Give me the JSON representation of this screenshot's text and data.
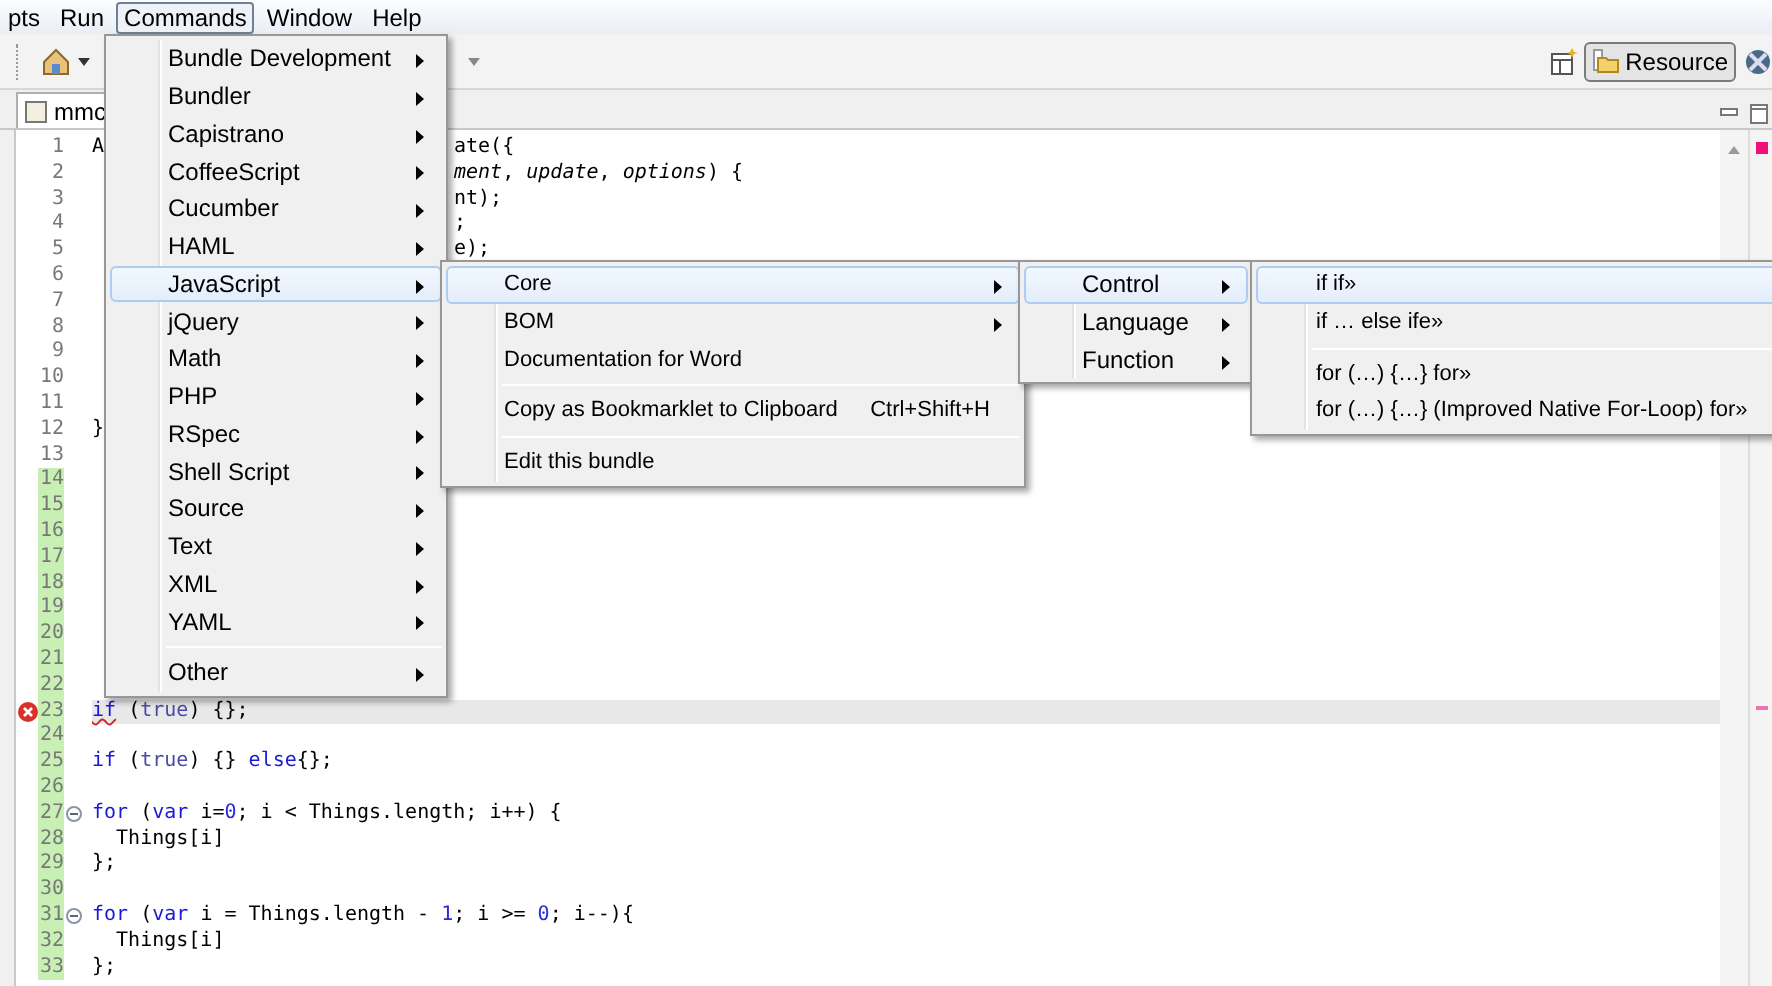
{
  "menu_bar": [
    {
      "label": "pts",
      "selected": false
    },
    {
      "label": "Run",
      "selected": false
    },
    {
      "label": "Commands",
      "selected": true
    },
    {
      "label": "Window",
      "selected": false
    },
    {
      "label": "Help",
      "selected": false
    }
  ],
  "toolbar": {
    "perspectives": [
      {
        "label": "Resource",
        "selected": true
      }
    ]
  },
  "editor": {
    "tab": "mmc",
    "lines": [
      {
        "number": "1",
        "changed": false,
        "left": [
          {
            "text": "A"
          }
        ],
        "right": [
          {
            "text": "ate({"
          }
        ]
      },
      {
        "number": "2",
        "changed": false,
        "right": [
          {
            "text": "ment",
            "kind": "param"
          },
          {
            "text": ", "
          },
          {
            "text": "update",
            "kind": "param"
          },
          {
            "text": ", "
          },
          {
            "text": "options",
            "kind": "param"
          },
          {
            "text": ") {"
          }
        ]
      },
      {
        "number": "3",
        "changed": false,
        "right": [
          {
            "text": "nt);"
          }
        ]
      },
      {
        "number": "4",
        "changed": false,
        "right": [
          {
            "text": ";"
          }
        ]
      },
      {
        "number": "5",
        "changed": false,
        "right": [
          {
            "text": "e);"
          }
        ]
      },
      {
        "number": "6",
        "changed": false
      },
      {
        "number": "7",
        "changed": false
      },
      {
        "number": "8",
        "changed": false
      },
      {
        "number": "9",
        "changed": false
      },
      {
        "number": "10",
        "changed": false
      },
      {
        "number": "11",
        "changed": false
      },
      {
        "number": "12",
        "changed": false,
        "left": [
          {
            "text": "}"
          }
        ]
      },
      {
        "number": "13",
        "changed": false
      },
      {
        "number": "14",
        "changed": true
      },
      {
        "number": "15",
        "changed": true
      },
      {
        "number": "16",
        "changed": true
      },
      {
        "number": "17",
        "changed": true
      },
      {
        "number": "18",
        "changed": true
      },
      {
        "number": "19",
        "changed": true
      },
      {
        "number": "20",
        "changed": true
      },
      {
        "number": "21",
        "changed": true
      },
      {
        "number": "22",
        "changed": true
      },
      {
        "number": "23",
        "changed": true,
        "error": true,
        "current": true,
        "left": [
          {
            "text": "if",
            "kind": "keyword",
            "error": true
          },
          {
            "text": " ("
          },
          {
            "text": "true",
            "kind": "literal"
          },
          {
            "text": ") {};"
          }
        ]
      },
      {
        "number": "24",
        "changed": true
      },
      {
        "number": "25",
        "changed": true,
        "left": [
          {
            "text": "if",
            "kind": "keyword"
          },
          {
            "text": " ("
          },
          {
            "text": "true",
            "kind": "literal"
          },
          {
            "text": ") {} "
          },
          {
            "text": "else",
            "kind": "keyword"
          },
          {
            "text": "{};"
          }
        ]
      },
      {
        "number": "26",
        "changed": true
      },
      {
        "number": "27",
        "changed": true,
        "fold": true,
        "left": [
          {
            "text": "for",
            "kind": "keyword"
          },
          {
            "text": " ("
          },
          {
            "text": "var",
            "kind": "keyword"
          },
          {
            "text": " i="
          },
          {
            "text": "0",
            "kind": "number"
          },
          {
            "text": "; i < Things.length; i++) {"
          }
        ]
      },
      {
        "number": "28",
        "changed": true,
        "left": [
          {
            "text": "  Things[i]"
          }
        ]
      },
      {
        "number": "29",
        "changed": true,
        "left": [
          {
            "text": "};"
          }
        ]
      },
      {
        "number": "30",
        "changed": true
      },
      {
        "number": "31",
        "changed": true,
        "fold": true,
        "left": [
          {
            "text": "for",
            "kind": "keyword"
          },
          {
            "text": " ("
          },
          {
            "text": "var",
            "kind": "keyword"
          },
          {
            "text": " i = Things.length - "
          },
          {
            "text": "1",
            "kind": "number"
          },
          {
            "text": "; i >= "
          },
          {
            "text": "0",
            "kind": "number"
          },
          {
            "text": "; i--){"
          }
        ]
      },
      {
        "number": "32",
        "changed": true,
        "left": [
          {
            "text": "  Things[i]"
          }
        ]
      },
      {
        "number": "33",
        "changed": true,
        "left": [
          {
            "text": "};"
          }
        ]
      }
    ]
  },
  "menus": [
    {
      "items": [
        {
          "kind": "item",
          "label": "Bundle Development",
          "submenu": true,
          "selected": false
        },
        {
          "kind": "item",
          "label": "Bundler",
          "submenu": true,
          "selected": false
        },
        {
          "kind": "item",
          "label": "Capistrano",
          "submenu": true,
          "selected": false
        },
        {
          "kind": "item",
          "label": "CoffeeScript",
          "submenu": true,
          "selected": false
        },
        {
          "kind": "item",
          "label": "Cucumber",
          "submenu": true,
          "selected": false
        },
        {
          "kind": "item",
          "label": "HAML",
          "submenu": true,
          "selected": false
        },
        {
          "kind": "item",
          "label": "JavaScript",
          "submenu": true,
          "selected": true
        },
        {
          "kind": "item",
          "label": "jQuery",
          "submenu": true,
          "selected": false
        },
        {
          "kind": "item",
          "label": "Math",
          "submenu": true,
          "selected": false
        },
        {
          "kind": "item",
          "label": "PHP",
          "submenu": true,
          "selected": false
        },
        {
          "kind": "item",
          "label": "RSpec",
          "submenu": true,
          "selected": false
        },
        {
          "kind": "item",
          "label": "Shell Script",
          "submenu": true,
          "selected": false
        },
        {
          "kind": "item",
          "label": "Source",
          "submenu": true,
          "selected": false
        },
        {
          "kind": "item",
          "label": "Text",
          "submenu": true,
          "selected": false
        },
        {
          "kind": "item",
          "label": "XML",
          "submenu": true,
          "selected": false
        },
        {
          "kind": "item",
          "label": "YAML",
          "submenu": true,
          "selected": false
        },
        {
          "kind": "separator"
        },
        {
          "kind": "item",
          "label": "Other",
          "submenu": true,
          "selected": false
        }
      ]
    },
    {
      "items": [
        {
          "kind": "item",
          "label": "Core",
          "submenu": true,
          "selected": true
        },
        {
          "kind": "item",
          "label": "BOM",
          "submenu": true,
          "selected": false
        },
        {
          "kind": "item",
          "label": "Documentation for Word",
          "submenu": false,
          "selected": false
        },
        {
          "kind": "separator"
        },
        {
          "kind": "item",
          "label": "Copy as Bookmarklet to Clipboard",
          "shortcut": "Ctrl+Shift+H",
          "submenu": false,
          "selected": false
        },
        {
          "kind": "separator"
        },
        {
          "kind": "item",
          "label": "Edit this bundle",
          "submenu": false,
          "selected": false
        }
      ]
    },
    {
      "items": [
        {
          "kind": "item",
          "label": "Control",
          "submenu": true,
          "selected": true
        },
        {
          "kind": "item",
          "label": "Language",
          "submenu": true,
          "selected": false
        },
        {
          "kind": "item",
          "label": "Function",
          "submenu": true,
          "selected": false
        }
      ]
    },
    {
      "items": [
        {
          "kind": "item",
          "label": "if if»",
          "submenu": false,
          "selected": true
        },
        {
          "kind": "item",
          "label": "if … else ife»",
          "submenu": false,
          "selected": false
        },
        {
          "kind": "separator"
        },
        {
          "kind": "item",
          "label": "for (…) {…} for»",
          "submenu": false,
          "selected": false
        },
        {
          "kind": "item",
          "label": "for (…) {…} (Improved Native For-Loop) for»",
          "submenu": false,
          "selected": false
        }
      ]
    }
  ]
}
